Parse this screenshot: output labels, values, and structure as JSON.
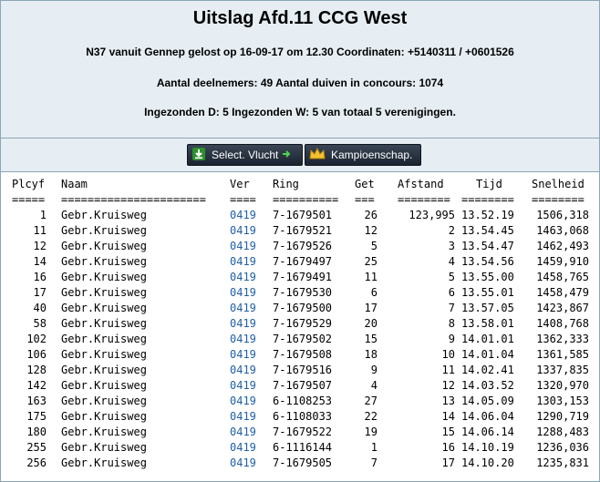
{
  "header": {
    "title": "Uitslag Afd.11 CCG West",
    "line1": "N37 vanuit Gennep gelost op 16-09-17 om 12.30 Coordinaten: +5140311 / +0601526",
    "line2": "Aantal deelnemers: 49 Aantal duiven in concours: 1074",
    "line3": "Ingezonden D: 5 Ingezonden W: 5 van totaal 5 verenigingen."
  },
  "toolbar": {
    "select_label": "Select. Vlucht",
    "champ_label": "Kampioenschap.",
    "select_icon": "download-arrow-icon",
    "champ_icon": "crown-icon"
  },
  "table": {
    "headers": {
      "plcyf": "Plcyf",
      "naam": "Naam",
      "ver": "Ver",
      "ring": "Ring",
      "get": "Get",
      "afstand": "Afstand",
      "tijd": "Tijd",
      "snelheid": "Snelheid"
    },
    "separators": {
      "plcyf": "=====",
      "naam": "======================",
      "ver": "====",
      "ring": "==========",
      "get": "===",
      "afstand": "========",
      "tijd": "========",
      "snelheid": "========"
    },
    "rows": [
      {
        "plcyf": "1",
        "naam": "Gebr.Kruisweg",
        "ver": "0419",
        "ring": "7-1679501",
        "get": "26",
        "afstand": "123,995",
        "tijd": "13.52.19",
        "snelheid": "1506,318"
      },
      {
        "plcyf": "11",
        "naam": "Gebr.Kruisweg",
        "ver": "0419",
        "ring": "7-1679521",
        "get": "12",
        "afstand": "2",
        "tijd": "13.54.45",
        "snelheid": "1463,068"
      },
      {
        "plcyf": "12",
        "naam": "Gebr.Kruisweg",
        "ver": "0419",
        "ring": "7-1679526",
        "get": "5",
        "afstand": "3",
        "tijd": "13.54.47",
        "snelheid": "1462,493"
      },
      {
        "plcyf": "14",
        "naam": "Gebr.Kruisweg",
        "ver": "0419",
        "ring": "7-1679497",
        "get": "25",
        "afstand": "4",
        "tijd": "13.54.56",
        "snelheid": "1459,910"
      },
      {
        "plcyf": "16",
        "naam": "Gebr.Kruisweg",
        "ver": "0419",
        "ring": "7-1679491",
        "get": "11",
        "afstand": "5",
        "tijd": "13.55.00",
        "snelheid": "1458,765"
      },
      {
        "plcyf": "17",
        "naam": "Gebr.Kruisweg",
        "ver": "0419",
        "ring": "7-1679530",
        "get": "6",
        "afstand": "6",
        "tijd": "13.55.01",
        "snelheid": "1458,479"
      },
      {
        "plcyf": "40",
        "naam": "Gebr.Kruisweg",
        "ver": "0419",
        "ring": "7-1679500",
        "get": "17",
        "afstand": "7",
        "tijd": "13.57.05",
        "snelheid": "1423,867"
      },
      {
        "plcyf": "58",
        "naam": "Gebr.Kruisweg",
        "ver": "0419",
        "ring": "7-1679529",
        "get": "20",
        "afstand": "8",
        "tijd": "13.58.01",
        "snelheid": "1408,768"
      },
      {
        "plcyf": "102",
        "naam": "Gebr.Kruisweg",
        "ver": "0419",
        "ring": "7-1679502",
        "get": "15",
        "afstand": "9",
        "tijd": "14.01.01",
        "snelheid": "1362,333"
      },
      {
        "plcyf": "106",
        "naam": "Gebr.Kruisweg",
        "ver": "0419",
        "ring": "7-1679508",
        "get": "18",
        "afstand": "10",
        "tijd": "14.01.04",
        "snelheid": "1361,585"
      },
      {
        "plcyf": "128",
        "naam": "Gebr.Kruisweg",
        "ver": "0419",
        "ring": "7-1679516",
        "get": "9",
        "afstand": "11",
        "tijd": "14.02.41",
        "snelheid": "1337,835"
      },
      {
        "plcyf": "142",
        "naam": "Gebr.Kruisweg",
        "ver": "0419",
        "ring": "7-1679507",
        "get": "4",
        "afstand": "12",
        "tijd": "14.03.52",
        "snelheid": "1320,970"
      },
      {
        "plcyf": "163",
        "naam": "Gebr.Kruisweg",
        "ver": "0419",
        "ring": "6-1108253",
        "get": "27",
        "afstand": "13",
        "tijd": "14.05.09",
        "snelheid": "1303,153"
      },
      {
        "plcyf": "175",
        "naam": "Gebr.Kruisweg",
        "ver": "0419",
        "ring": "6-1108033",
        "get": "22",
        "afstand": "14",
        "tijd": "14.06.04",
        "snelheid": "1290,719"
      },
      {
        "plcyf": "180",
        "naam": "Gebr.Kruisweg",
        "ver": "0419",
        "ring": "7-1679522",
        "get": "19",
        "afstand": "15",
        "tijd": "14.06.14",
        "snelheid": "1288,483"
      },
      {
        "plcyf": "255",
        "naam": "Gebr.Kruisweg",
        "ver": "0419",
        "ring": "6-1116144",
        "get": "1",
        "afstand": "16",
        "tijd": "14.10.19",
        "snelheid": "1236,036"
      },
      {
        "plcyf": "256",
        "naam": "Gebr.Kruisweg",
        "ver": "0419",
        "ring": "7-1679505",
        "get": "7",
        "afstand": "17",
        "tijd": "14.10.20",
        "snelheid": "1235,831"
      }
    ]
  }
}
